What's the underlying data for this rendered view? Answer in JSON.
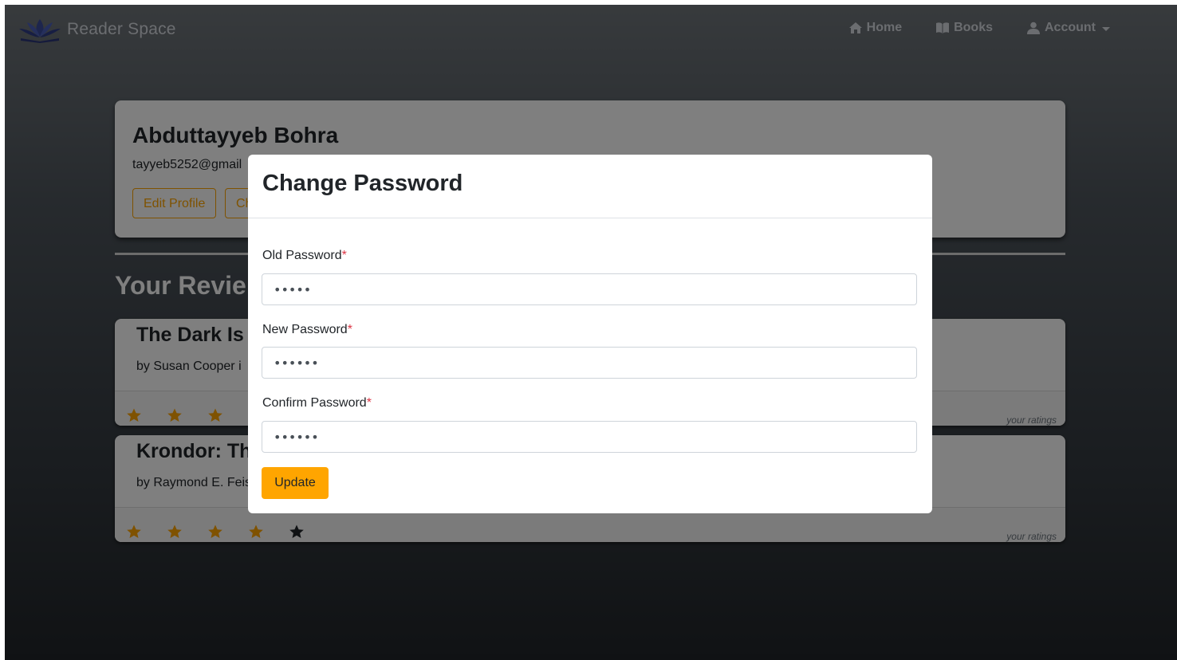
{
  "navbar": {
    "brand": "Reader Space",
    "items": [
      {
        "label": "Home",
        "icon": "home-icon"
      },
      {
        "label": "Books",
        "icon": "book-icon"
      },
      {
        "label": "Account",
        "icon": "user-icon"
      }
    ]
  },
  "profile": {
    "name": "Abduttayyeb Bohra",
    "email": "tayyeb5252@gmail",
    "edit_label": "Edit Profile",
    "change_password_label": "Ch"
  },
  "reviews_section": {
    "title": "Your Revie",
    "items": [
      {
        "title": "The Dark Is",
        "author": "by Susan Cooper i",
        "rating": 3,
        "ratings_label": "your ratings"
      },
      {
        "title": "Krondor: Th",
        "author": "by Raymond E. Feis",
        "rating": 4,
        "ratings_label": "your ratings"
      }
    ]
  },
  "modal": {
    "title": "Change Password",
    "old_password_label": "Old Password",
    "old_password_value": "12345",
    "new_password_label": "New Password",
    "new_password_value": "123456",
    "confirm_password_label": "Confirm Password",
    "confirm_password_value": "123456",
    "required_marker": "*",
    "submit_label": "Update"
  },
  "colors": {
    "accent": "#ffa500",
    "star_filled": "#ffa500",
    "star_empty": "#212529",
    "required": "#dc3545"
  }
}
